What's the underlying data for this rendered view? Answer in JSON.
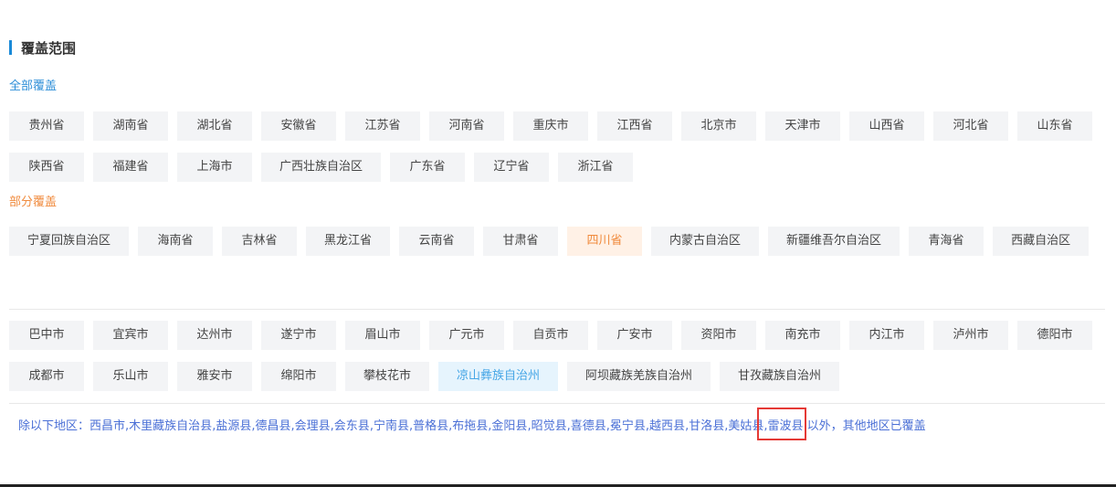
{
  "section": {
    "title": "覆盖范围"
  },
  "full_coverage": {
    "label": "全部覆盖",
    "items": [
      "贵州省",
      "湖南省",
      "湖北省",
      "安徽省",
      "江苏省",
      "河南省",
      "重庆市",
      "江西省",
      "北京市",
      "天津市",
      "山西省",
      "河北省",
      "山东省",
      "陕西省",
      "福建省",
      "上海市",
      "广西壮族自治区",
      "广东省",
      "辽宁省",
      "浙江省"
    ]
  },
  "partial_coverage": {
    "label": "部分覆盖",
    "items": [
      "宁夏回族自治区",
      "海南省",
      "吉林省",
      "黑龙江省",
      "云南省",
      "甘肃省",
      "四川省",
      "内蒙古自治区",
      "新疆维吾尔自治区",
      "青海省",
      "西藏自治区"
    ],
    "selected": "四川省"
  },
  "sichuan_cities": {
    "items": [
      "巴中市",
      "宜宾市",
      "达州市",
      "遂宁市",
      "眉山市",
      "广元市",
      "自贡市",
      "广安市",
      "资阳市",
      "南充市",
      "内江市",
      "泸州市",
      "德阳市",
      "成都市",
      "乐山市",
      "雅安市",
      "绵阳市",
      "攀枝花市",
      "凉山彝族自治州",
      "阿坝藏族羌族自治州",
      "甘孜藏族自治州"
    ],
    "selected": "凉山彝族自治州"
  },
  "exclusion": {
    "prefix": "除以下地区：",
    "counties": [
      "西昌市",
      "木里藏族自治县",
      "盐源县",
      "德昌县",
      "会理县",
      "会东县",
      "宁南县",
      "普格县",
      "布拖县",
      "金阳县",
      "昭觉县",
      "喜德县",
      "冕宁县",
      "越西县",
      "甘洛县",
      "美姑县",
      "雷波县"
    ],
    "separator": ",",
    "suffix": " 以外，其他地区已覆盖",
    "highlighted": "美姑县"
  },
  "colors": {
    "accent_blue": "#2f8fd8",
    "partial_orange": "#f08a3c",
    "highlight_red": "#e53935"
  }
}
